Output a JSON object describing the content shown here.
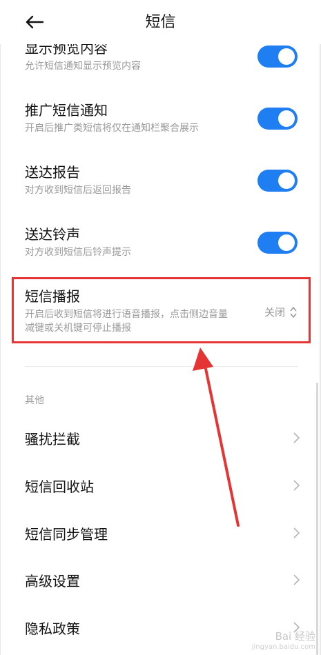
{
  "header": {
    "title": "短信",
    "back_icon": "arrow-left-icon"
  },
  "toggles": [
    {
      "title": "显示预览内容",
      "subtitle": "允许短信通知显示预览内容",
      "on": true
    },
    {
      "title": "推广短信通知",
      "subtitle": "开启后推广类短信将仅在通知栏聚合展示",
      "on": true
    },
    {
      "title": "送达报告",
      "subtitle": "对方收到短信后返回报告",
      "on": true
    },
    {
      "title": "送达铃声",
      "subtitle": "对方收到短信后铃声提示",
      "on": true
    }
  ],
  "broadcast": {
    "title": "短信播报",
    "subtitle_line1": "开启后收到短信将进行语音播报，点击侧边音量",
    "subtitle_line2": "减键或关机键可停止播报",
    "value": "关闭"
  },
  "other_section": {
    "label": "其他",
    "items": [
      {
        "label": "骚扰拦截"
      },
      {
        "label": "短信回收站"
      },
      {
        "label": "短信同步管理"
      },
      {
        "label": "高级设置"
      },
      {
        "label": "隐私政策"
      }
    ]
  },
  "watermark": {
    "line1": "Bai 经验",
    "line2": "jingyan.baidu.com"
  },
  "colors": {
    "toggle_on": "#1e7ef2",
    "annotation_red": "#e53434"
  }
}
